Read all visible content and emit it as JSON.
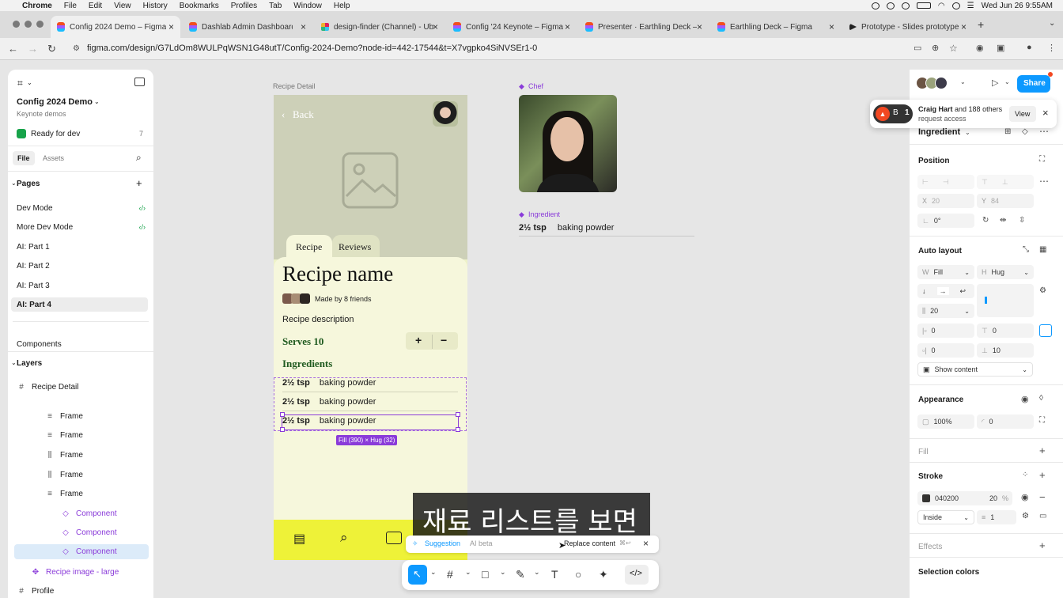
{
  "menubar": {
    "app": "Chrome",
    "items": [
      "File",
      "Edit",
      "View",
      "History",
      "Bookmarks",
      "Profiles",
      "Tab",
      "Window",
      "Help"
    ],
    "clock": "Wed Jun 26  9:55AM"
  },
  "tabs": [
    {
      "label": "Config 2024 Demo – Figma",
      "icon": "figma-icon"
    },
    {
      "label": "Dashlab Admin Dashboard UI",
      "icon": "figma-icon"
    },
    {
      "label": "design-finder (Channel) - Ub",
      "icon": "slack-icon"
    },
    {
      "label": "Config '24 Keynote – Figma",
      "icon": "figma-icon"
    },
    {
      "label": "Presenter · Earthling Deck – F",
      "icon": "figma-icon"
    },
    {
      "label": "Earthling Deck – Figma",
      "icon": "figma-icon"
    },
    {
      "label": "Prototype - Slides prototype",
      "icon": "play-icon"
    }
  ],
  "url": "figma.com/design/G7LdOm8WULPqWSN1G48utT/Config-2024-Demo?node-id=442-17544&t=X7vgpko4SiNVSEr1-0",
  "left": {
    "file_title": "Config 2024 Demo",
    "file_sub": "Keynote demos",
    "ready": "Ready for dev",
    "ready_count": "7",
    "tab_file": "File",
    "tab_assets": "Assets",
    "pages_header": "Pages",
    "pages": [
      "Dev Mode",
      "More Dev Mode",
      "AI: Part 1",
      "AI: Part 2",
      "AI: Part 3",
      "AI: Part 4"
    ],
    "components": "Components",
    "layers_header": "Layers",
    "layers": [
      {
        "label": "Recipe Detail"
      },
      {
        "label": "Frame"
      },
      {
        "label": "Frame"
      },
      {
        "label": "Frame"
      },
      {
        "label": "Frame"
      },
      {
        "label": "Frame"
      },
      {
        "label": "Component"
      },
      {
        "label": "Component"
      },
      {
        "label": "Component"
      },
      {
        "label": "Recipe image - large"
      },
      {
        "label": "Profile"
      }
    ]
  },
  "canvas": {
    "frame_label": "Recipe Detail",
    "chef_label": "Chef",
    "ingredient_label": "Ingredient",
    "ingredient_qty": "2½ tsp",
    "ingredient_name": "baking powder",
    "phone": {
      "back": "Back",
      "tab_recipe": "Recipe",
      "tab_reviews": "Reviews",
      "title": "Recipe name",
      "made_by": "Made by 8 friends",
      "description": "Recipe description",
      "serves": "Serves 10",
      "plus": "+",
      "minus": "−",
      "ingredients_header": "Ingredients",
      "rows": [
        {
          "qty": "2½ tsp",
          "name": "baking powder"
        },
        {
          "qty": "2½ tsp",
          "name": "baking powder"
        },
        {
          "qty": "2½ tsp",
          "name": "baking powder"
        }
      ],
      "size_badge": "Fill (390) × Hug (32)"
    },
    "subtitle": "재료 리스트를 보면",
    "suggestion": {
      "label": "Suggestion",
      "beta": "AI beta",
      "action": "Replace content",
      "shortcut": "⌘↩"
    }
  },
  "right": {
    "share": "Share",
    "notif_name": "Craig Hart",
    "notif_rest": "and 188 others",
    "notif_line2": "request access",
    "notif_count": "1",
    "notif_view": "View",
    "component_name": "Ingredient",
    "position": "Position",
    "x_label": "X",
    "x": "20",
    "y_label": "Y",
    "y": "84",
    "rotation": "0°",
    "auto_layout": "Auto layout",
    "w_label": "W",
    "w": "Fill",
    "h_label": "H",
    "h": "Hug",
    "gap": "20",
    "pad_l": "0",
    "pad_t": "0",
    "pad_r": "0",
    "pad_b": "10",
    "show_content": "Show content",
    "appearance": "Appearance",
    "opacity": "100%",
    "radius": "0",
    "fill": "Fill",
    "stroke": "Stroke",
    "stroke_color": "040200",
    "stroke_opacity": "20",
    "stroke_pct": "%",
    "stroke_pos": "Inside",
    "stroke_width": "1",
    "effects": "Effects",
    "selection_colors": "Selection colors"
  },
  "colors": {
    "accent": "#0d99ff",
    "phone_bg": "#eef2c9",
    "nav_yellow": "#eef238",
    "selection": "#8a3bd9",
    "title_green": "#1f5a1f"
  }
}
